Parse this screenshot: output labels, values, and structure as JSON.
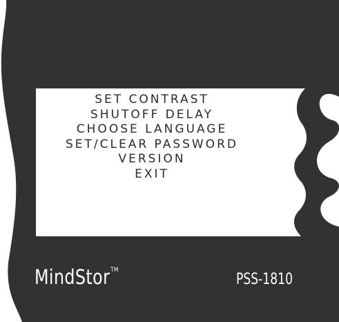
{
  "device": {
    "brand": "MindStor",
    "trademark": "TM",
    "model": "PSS-1810"
  },
  "menu": {
    "items": [
      {
        "label": "SET CONTRAST"
      },
      {
        "label": "SHUTOFF DELAY"
      },
      {
        "label": "CHOOSE LANGUAGE"
      },
      {
        "label": "SET/CLEAR PASSWORD"
      },
      {
        "label": "VERSION"
      },
      {
        "label": "EXIT"
      }
    ]
  },
  "colors": {
    "bezel": "#333132",
    "screen": "#ffffff",
    "text": "#2b2a2a",
    "label": "#ffffff"
  }
}
